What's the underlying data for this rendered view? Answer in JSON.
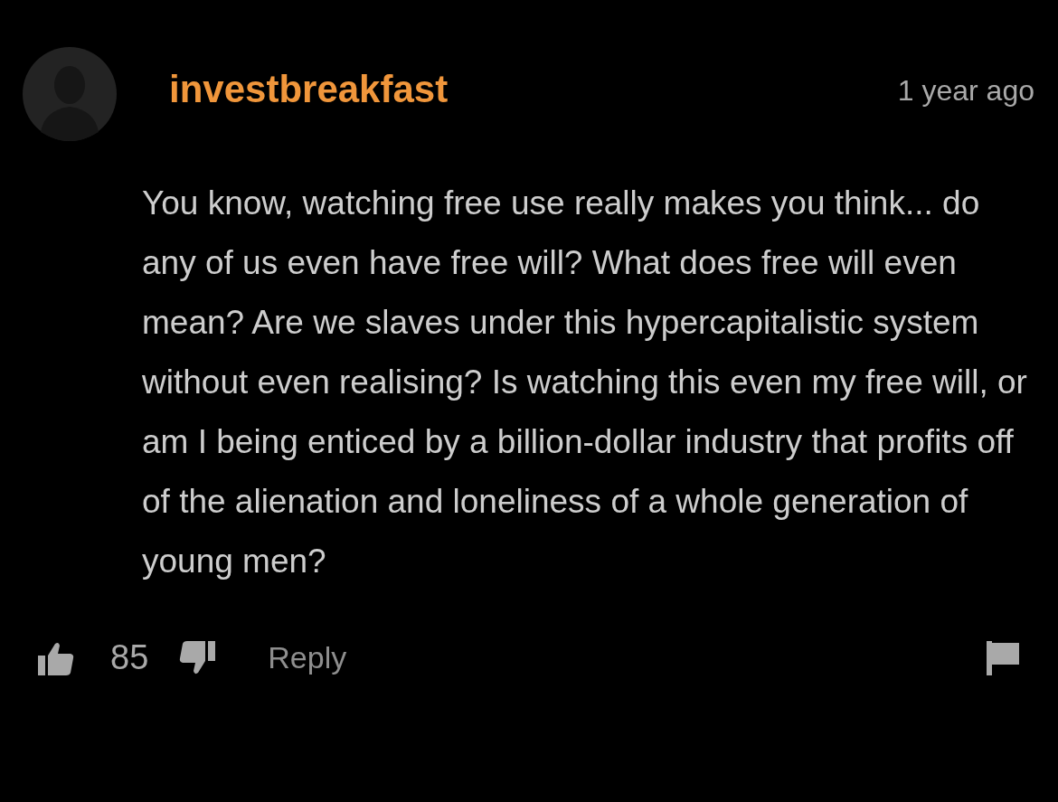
{
  "comment": {
    "username": "investbreakfast",
    "time": "1 year ago",
    "text": "You know, watching free use really makes you think... do any of us even have free will? What does free will even mean? Are we slaves under this hypercapitalistic system without even realising? Is watching this even my free will, or am I being enticed by a billion-dollar industry that profits off of the alienation and loneliness of a whole generation of young men?",
    "likes": "85",
    "reply": "Reply"
  }
}
